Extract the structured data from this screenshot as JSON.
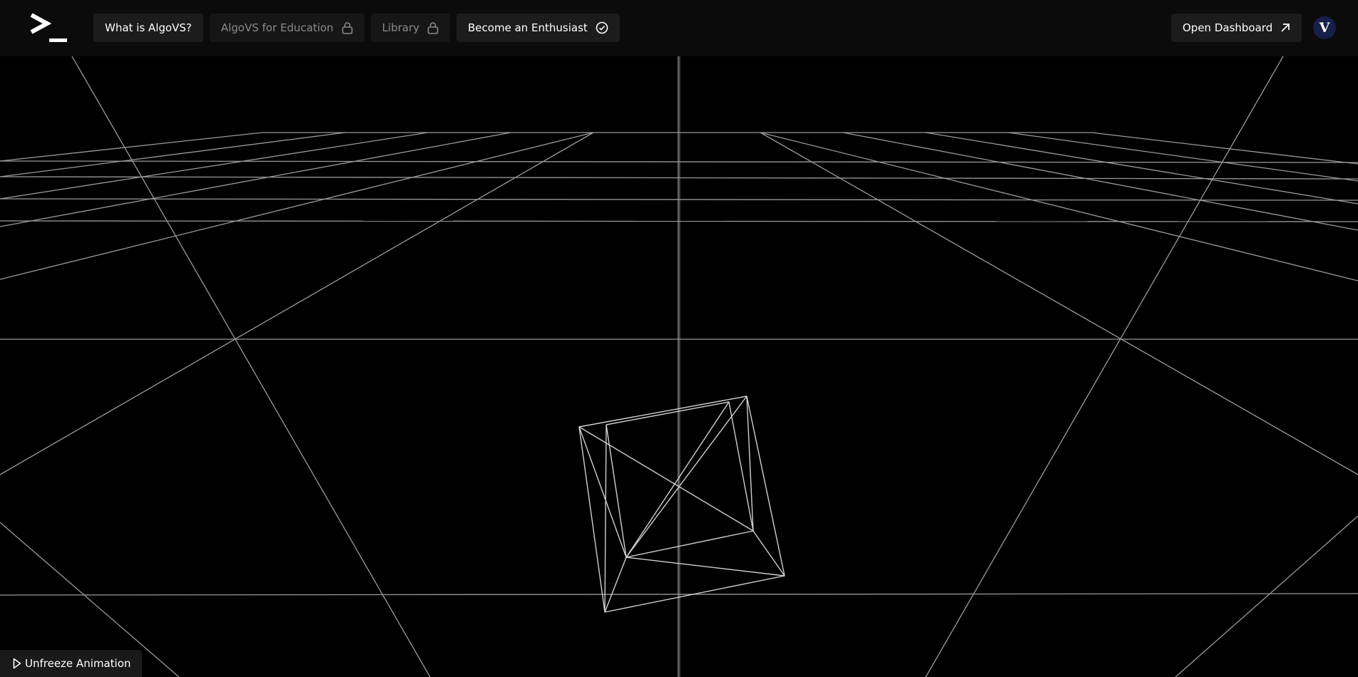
{
  "header": {
    "logo_icon": "terminal-prompt-icon",
    "nav": [
      {
        "label": "What is AlgoVS?",
        "locked": false
      },
      {
        "label": "AlgoVS for Education",
        "locked": true,
        "icon": "lock-icon"
      },
      {
        "label": "Library",
        "locked": true,
        "icon": "lock-icon"
      },
      {
        "label": "Become an Enthusiast",
        "locked": false,
        "icon": "check-circle-icon"
      }
    ],
    "dashboard_label": "Open Dashboard",
    "dashboard_icon": "arrow-up-right-icon",
    "avatar_letter": "V"
  },
  "scene": {
    "type": "3d-wireframe",
    "object": "octahedron-wireframe",
    "floor": "perspective-grid",
    "line_color": "#c8c8c8"
  },
  "footer": {
    "animation_button_label": "Unfreeze Animation",
    "animation_button_icon": "play-icon"
  },
  "colors": {
    "background": "#000000",
    "topbar": "#0b0b0b",
    "button": "#1c1c1c",
    "locked_text": "#8a8a8a",
    "avatar_bg": "#17204a"
  }
}
